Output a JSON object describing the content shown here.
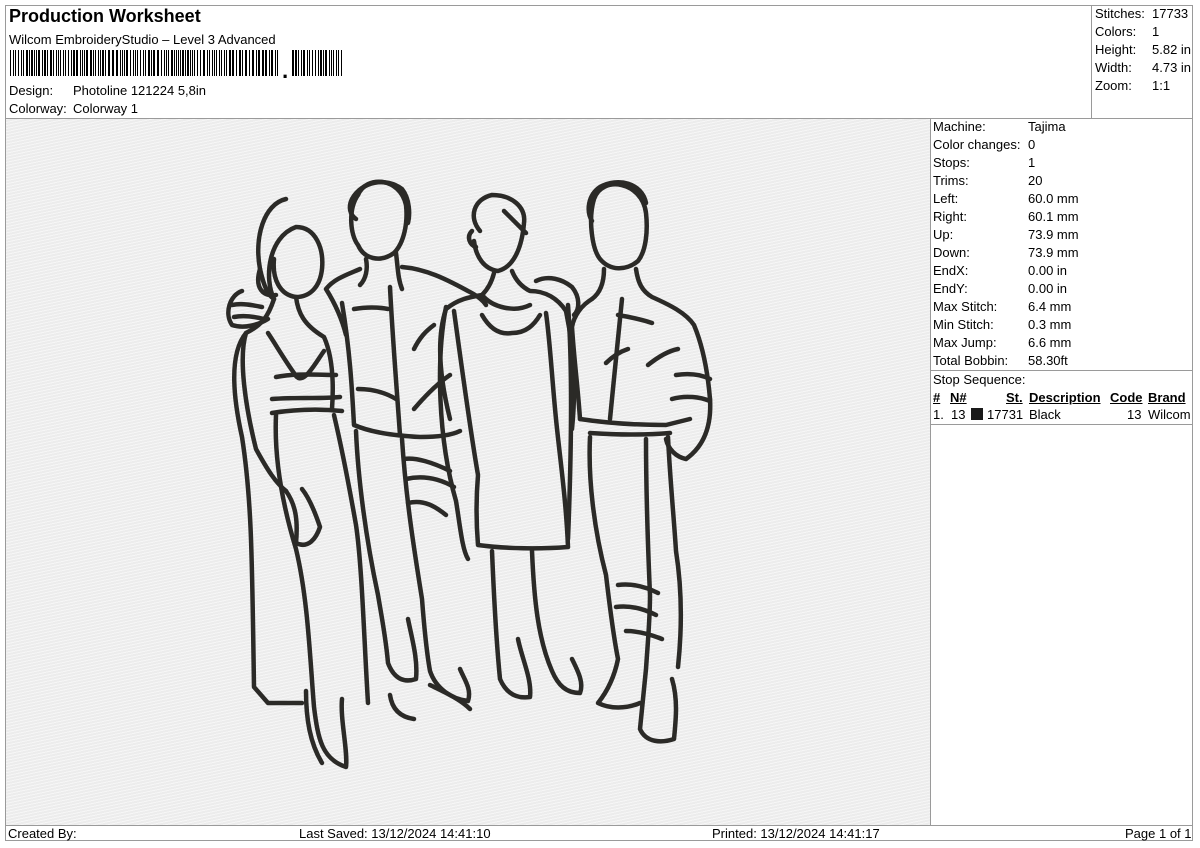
{
  "header": {
    "title": "Production Worksheet",
    "software": "Wilcom EmbroideryStudio – Level 3 Advanced",
    "design_label": "Design:",
    "design_value": "Photoline 121224 5,8in",
    "colorway_label": "Colorway:",
    "colorway_value": "Colorway 1"
  },
  "summary": [
    {
      "label": "Stitches:",
      "value": "17733"
    },
    {
      "label": "Colors:",
      "value": "1"
    },
    {
      "label": "Height:",
      "value": "5.82 in"
    },
    {
      "label": "Width:",
      "value": "4.73 in"
    },
    {
      "label": "Zoom:",
      "value": "1:1"
    }
  ],
  "machine_info": [
    {
      "label": "Machine:",
      "value": "Tajima"
    },
    {
      "label": "Color changes:",
      "value": "0"
    },
    {
      "label": "Stops:",
      "value": "1"
    },
    {
      "label": "Trims:",
      "value": "20"
    },
    {
      "label": "Left:",
      "value": "60.0 mm"
    },
    {
      "label": "Right:",
      "value": "60.1 mm"
    },
    {
      "label": "Up:",
      "value": "73.9 mm"
    },
    {
      "label": "Down:",
      "value": "73.9 mm"
    },
    {
      "label": "EndX:",
      "value": "0.00 in"
    },
    {
      "label": "EndY:",
      "value": "0.00 in"
    },
    {
      "label": "Max Stitch:",
      "value": "6.4 mm"
    },
    {
      "label": "Min Stitch:",
      "value": "0.3 mm"
    },
    {
      "label": "Max Jump:",
      "value": "6.6 mm"
    },
    {
      "label": "Total Bobbin:",
      "value": "58.30ft"
    }
  ],
  "stop_sequence": {
    "title": "Stop Sequence:",
    "columns": {
      "index": "#",
      "needle": "N#",
      "stitches": "St.",
      "description": "Description",
      "code": "Code",
      "brand": "Brand"
    },
    "rows": [
      {
        "index": "1.",
        "needle": "13",
        "swatch_color": "#1a1a1a",
        "stitches": "17731",
        "description": "Black",
        "code": "13",
        "brand": "Wilcom"
      }
    ]
  },
  "footer": {
    "created_by": "Created By:",
    "last_saved": "Last Saved: 13/12/2024 14:41:10",
    "printed": "Printed: 13/12/2024 14:41:17",
    "page": "Page 1 of 1"
  },
  "colors": {
    "thread": "#2b2a27",
    "canvas": "#ececec",
    "border": "#9a9a9a"
  }
}
